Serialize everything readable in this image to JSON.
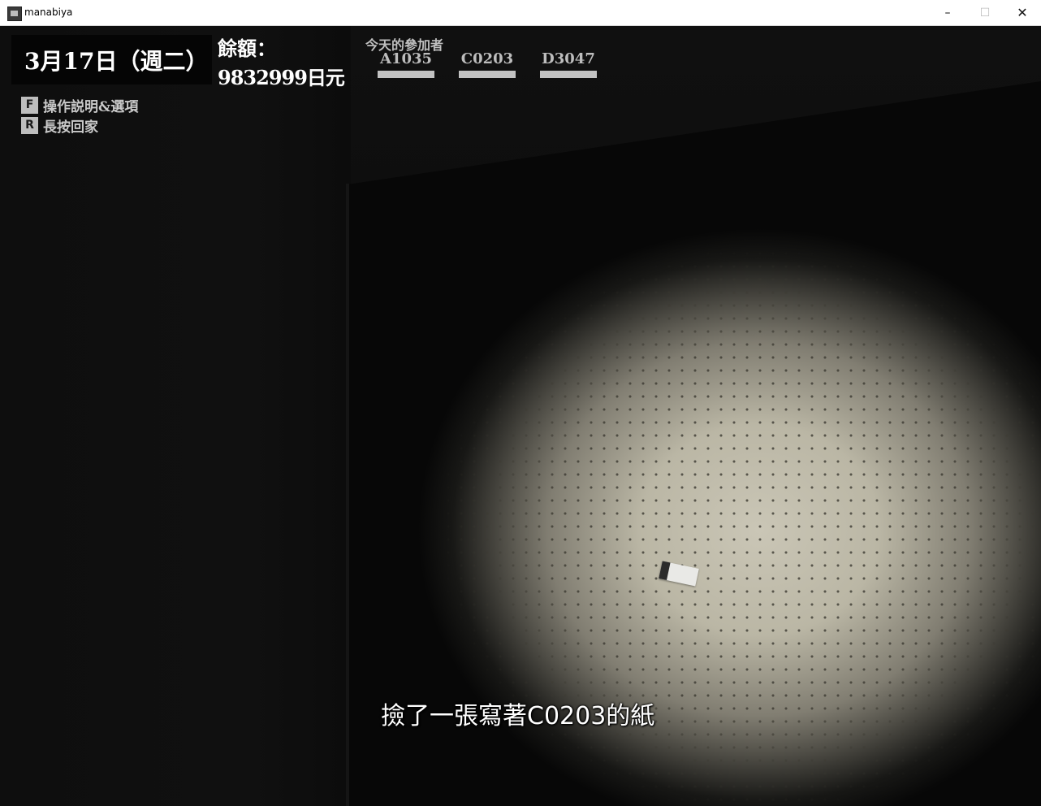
{
  "window": {
    "title": "manabiya",
    "minimize_glyph": "–",
    "maximize_glyph": "☐",
    "close_glyph": "✕"
  },
  "hud": {
    "date": "3月17日（週二）",
    "balance_label": "餘額：",
    "balance_value": "9832999日元",
    "controls": [
      {
        "key": "F",
        "label": "操作説明&選項"
      },
      {
        "key": "R",
        "label": "長按回家"
      }
    ],
    "participants_title": "今天的參加者",
    "participants": [
      {
        "id": "A1035",
        "bar_fill": 1.0
      },
      {
        "id": "C0203",
        "bar_fill": 1.0
      },
      {
        "id": "D3047",
        "bar_fill": 1.0
      }
    ]
  },
  "subtitle": "撿了一張寫著C0203的紙",
  "colors": {
    "background": "#000000",
    "hud_text": "#ffffff",
    "hint_text": "#c9c9c9",
    "bar": "#c2c2c2",
    "spotlight": "#cac6b6"
  }
}
